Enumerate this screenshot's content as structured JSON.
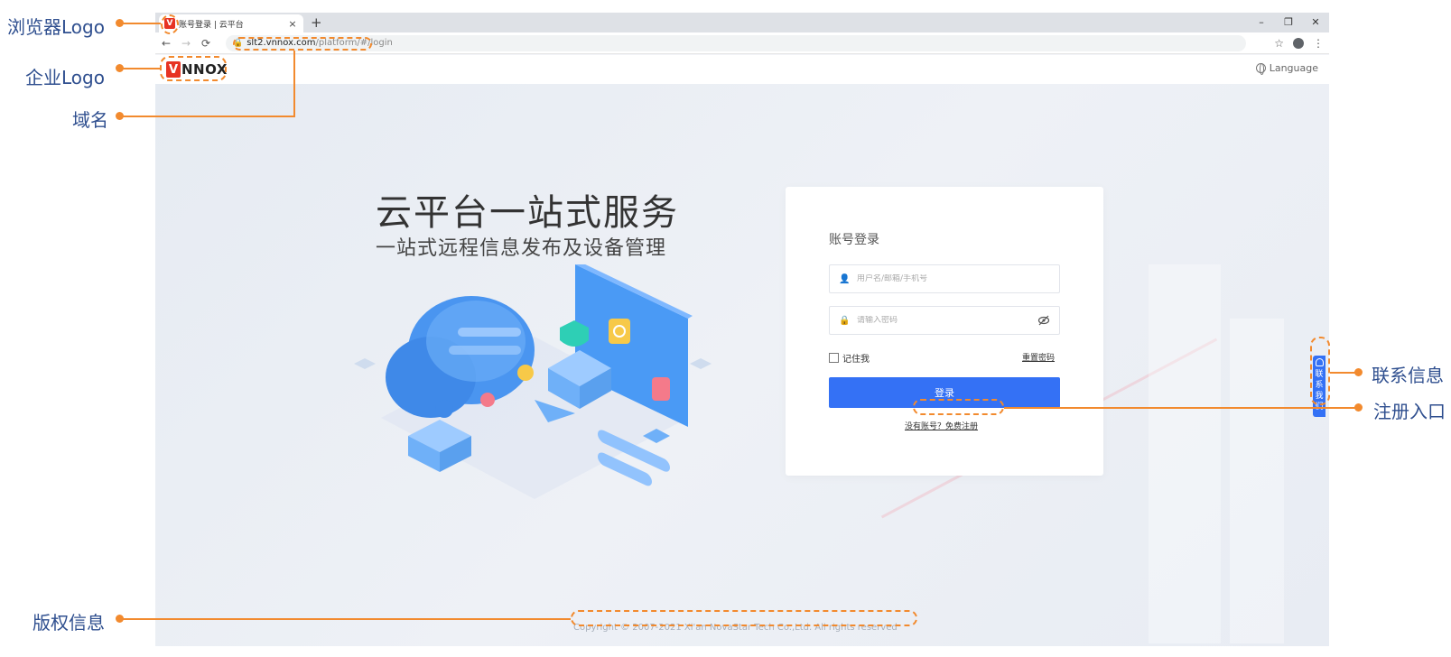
{
  "browser": {
    "tab_title": "账号登录 | 云平台",
    "tab_close": "×",
    "new_tab": "+",
    "favicon_letter": "V",
    "window_controls": {
      "minimize": "–",
      "maximize": "❐",
      "close": "✕"
    },
    "nav": {
      "back": "←",
      "forward": "→",
      "reload": "⟳"
    },
    "url_host": "slt2.vnnox.com",
    "url_path": "/platform/#/login",
    "star": "☆",
    "menu": "⋮"
  },
  "header": {
    "logo_mark": "V",
    "logo_text": "NNOX",
    "language": "Language"
  },
  "hero": {
    "title": "云平台一站式服务",
    "subtitle": "一站式远程信息发布及设备管理"
  },
  "login": {
    "title": "账号登录",
    "username_placeholder": "用户名/邮箱/手机号",
    "password_placeholder": "请输入密码",
    "remember_label": "记住我",
    "reset_link": "重置密码",
    "submit_label": "登录",
    "register_link": "没有账号？免费注册"
  },
  "contact": {
    "chars": [
      "联",
      "系",
      "我",
      "们"
    ]
  },
  "footer": {
    "copyright": "Copyright © 2007-2021 Xi'an NovaStar Tech Co.,Ltd. All rights reserved"
  },
  "annotations": {
    "browser_logo": "浏览器Logo",
    "company_logo": "企业Logo",
    "domain": "域名",
    "contact_info": "联系信息",
    "register_entry": "注册入口",
    "copyright_info": "版权信息"
  },
  "colors": {
    "primary": "#3471f5",
    "annotation_orange": "#f28a2e",
    "annotation_text": "#2f4f8f",
    "brand_red": "#e73323"
  }
}
